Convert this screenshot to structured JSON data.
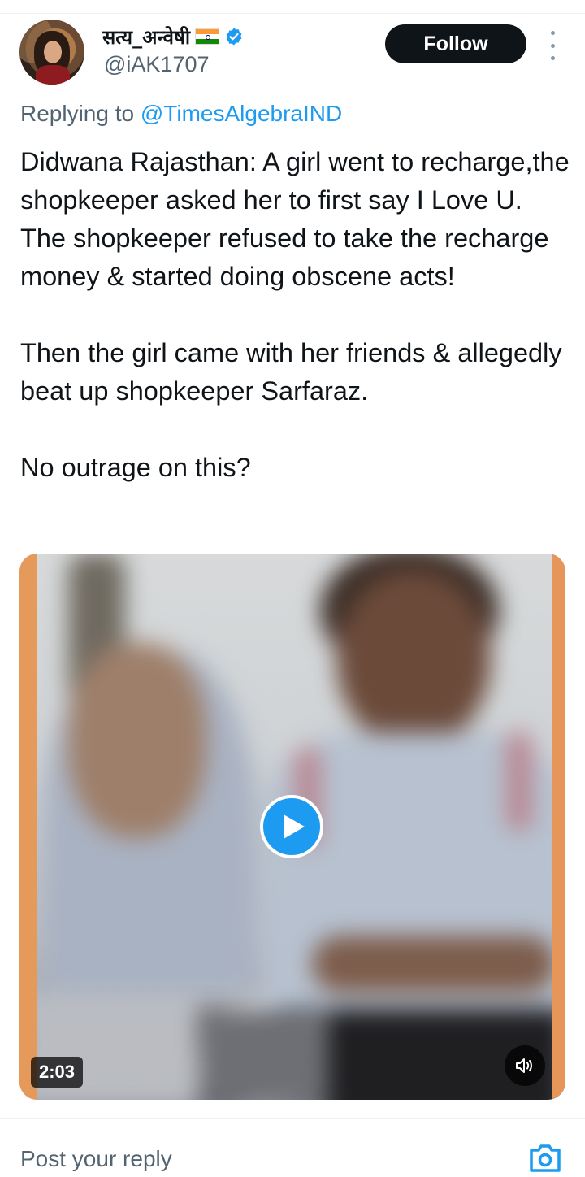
{
  "author": {
    "display_name": "सत्य_अन्वेषी",
    "handle": "@iAK1707",
    "verified": true,
    "flag": "india-flag"
  },
  "header": {
    "follow_label": "Follow",
    "more_icon": "more-vertical-icon"
  },
  "reply_context": {
    "prefix": "Replying to ",
    "mention": "@TimesAlgebraIND"
  },
  "tweet": {
    "paragraphs": [
      "Didwana Rajasthan: A girl went to recharge,the shopkeeper asked her to first say I Love U. The shopkeeper refused to take the recharge money & started doing obscene acts!",
      "Then the girl came with her friends & allegedly beat up shopkeeper Sarfaraz.",
      "No outrage on this?"
    ]
  },
  "media": {
    "type": "video",
    "duration": "2:03",
    "play_icon": "play-icon",
    "sound_icon": "volume-icon"
  },
  "reply_bar": {
    "placeholder": "Post your reply",
    "camera_icon": "camera-icon"
  },
  "colors": {
    "accent": "#1d9bf0",
    "text": "#0f1419",
    "secondary": "#536471",
    "button": "#0f1419"
  }
}
